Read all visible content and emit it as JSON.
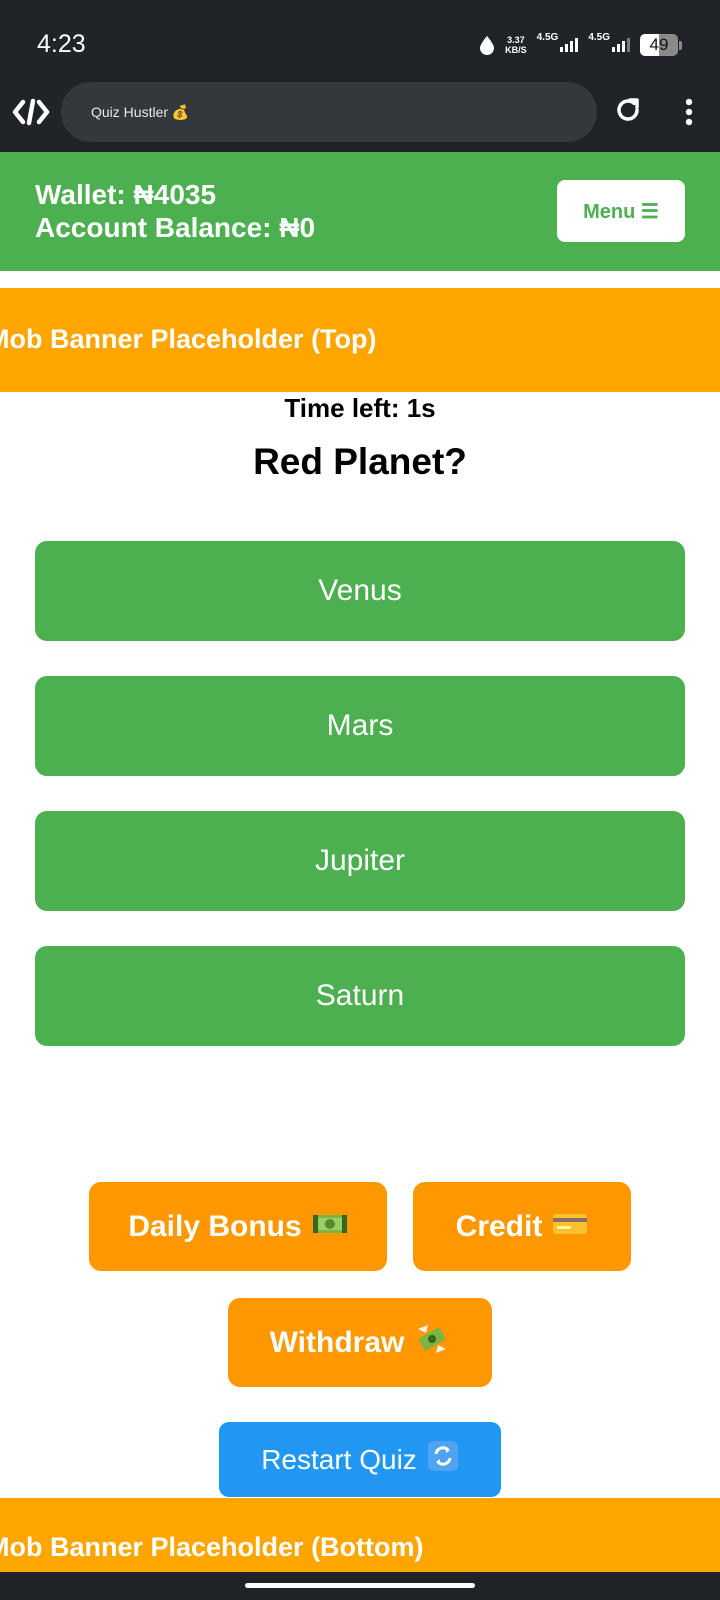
{
  "status_bar": {
    "time": "4:23",
    "speed_value": "3.37",
    "speed_unit": "KB/S",
    "network1": "4.5G",
    "network2": "4.5G",
    "battery": "49",
    "battery_level_percent": 49
  },
  "browser": {
    "url_text": "Quiz Hustler 💰"
  },
  "header": {
    "wallet": "Wallet: ₦4035",
    "account_balance": "Account Balance: ₦0",
    "menu_label": "Menu ☰"
  },
  "banners": {
    "top": "Mob Banner Placeholder (Top)",
    "bottom": "Mob Banner Placeholder (Bottom)"
  },
  "quiz": {
    "timer": "Time left: 1s",
    "question": "Red Planet?",
    "options": [
      "Venus",
      "Mars",
      "Jupiter",
      "Saturn"
    ]
  },
  "actions": {
    "daily_bonus": "Daily Bonus",
    "credit": "Credit",
    "withdraw": "Withdraw",
    "restart": "Restart Quiz"
  },
  "colors": {
    "green": "#4caf50",
    "orange": "#ff9800",
    "banner_orange": "#ffa500",
    "blue": "#2196f3",
    "dark": "#202327"
  },
  "icons": [
    "drop-icon",
    "signal-icon",
    "battery-icon",
    "site-logo-icon",
    "reload-icon",
    "more-vert-icon",
    "dollar-bill-icon",
    "credit-card-icon",
    "money-wings-icon",
    "restart-arrows-icon"
  ]
}
